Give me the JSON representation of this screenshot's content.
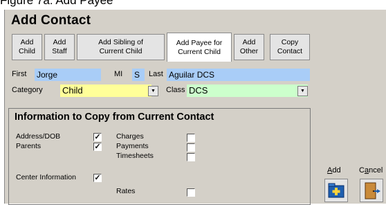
{
  "caption": "Figure 7a: Add Payee",
  "dialog": {
    "title": "Add Contact",
    "buttons": [
      {
        "id": "add-child",
        "label": "Add\nChild"
      },
      {
        "id": "add-staff",
        "label": "Add\nStaff"
      },
      {
        "id": "add-sibling",
        "label": "Add Sibling of\nCurrent Child"
      },
      {
        "id": "add-payee",
        "label": "Add Payee for\nCurrent Child",
        "active": true
      },
      {
        "id": "add-other",
        "label": "Add\nOther"
      },
      {
        "id": "copy-contact",
        "label": "Copy\nContact"
      }
    ],
    "form": {
      "first_label": "First",
      "first_value": "Jorge",
      "mi_label": "MI",
      "mi_value": "S",
      "last_label": "Last",
      "last_value": "Aguilar DCS",
      "category_label": "Category",
      "category_value": "Child",
      "class_label": "Class",
      "class_value": "DCS"
    },
    "copy_panel": {
      "title": "Information to Copy from Current Contact",
      "items": [
        {
          "label": "Address/DOB",
          "checked": true
        },
        {
          "label": "Parents",
          "checked": true
        },
        {
          "label": "Center Information",
          "checked": true
        },
        {
          "label": "Charges",
          "checked": false
        },
        {
          "label": "Payments",
          "checked": false
        },
        {
          "label": "Timesheets",
          "checked": false
        },
        {
          "label": "Rates",
          "checked": false
        }
      ]
    },
    "actions": {
      "add_label": "Add",
      "cancel_label": "Cancel",
      "add_icon": "add-folder-icon",
      "cancel_icon": "exit-door-icon"
    },
    "colors": {
      "name_field": "#a9cdf7",
      "category_field": "#ffff99",
      "class_field": "#ccffcc",
      "dialog_bg": "#d4d0c8"
    }
  }
}
